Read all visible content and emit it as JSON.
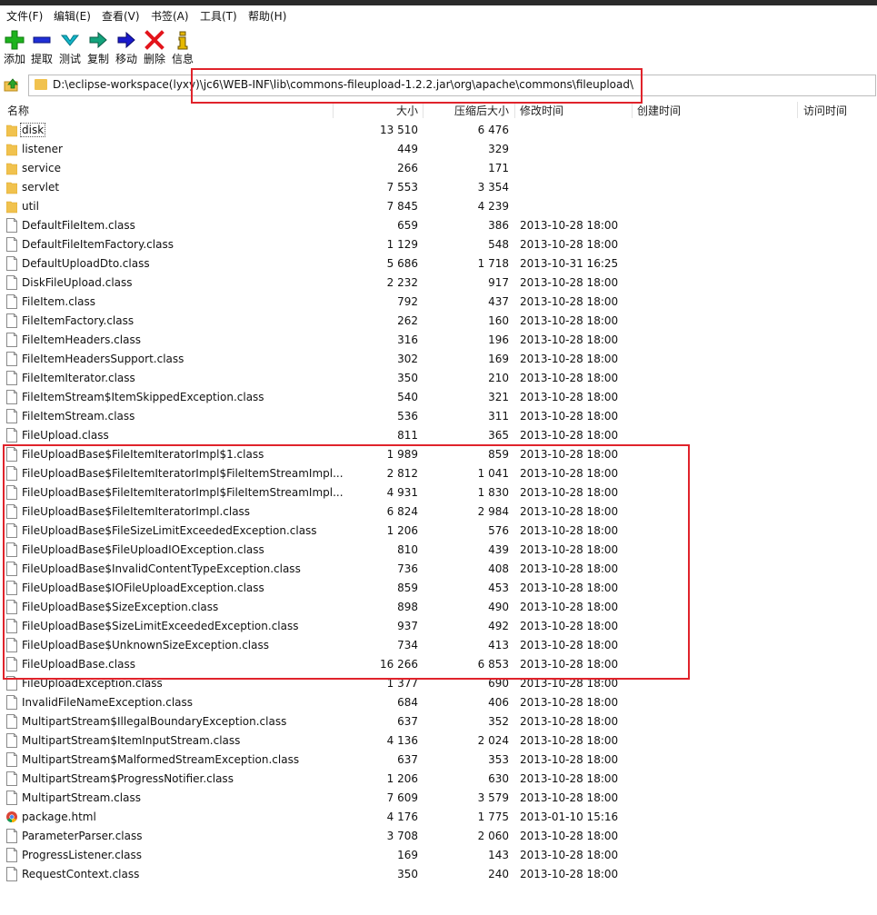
{
  "menu": [
    "文件(F)",
    "编辑(E)",
    "查看(V)",
    "书签(A)",
    "工具(T)",
    "帮助(H)"
  ],
  "toolbar": [
    {
      "label": "添加",
      "icon": "add-icon",
      "color": "#1db31d"
    },
    {
      "label": "提取",
      "icon": "extract-icon",
      "color": "#1f2fd6"
    },
    {
      "label": "测试",
      "icon": "test-icon",
      "color": "#12b5c9"
    },
    {
      "label": "复制",
      "icon": "copy-icon",
      "color": "#0f8a6a"
    },
    {
      "label": "移动",
      "icon": "move-icon",
      "color": "#1a1acc"
    },
    {
      "label": "删除",
      "icon": "delete-icon",
      "color": "#e3141b"
    },
    {
      "label": "信息",
      "icon": "info-icon",
      "color": "#e6b800"
    }
  ],
  "address": {
    "path": "D:\\eclipse-workspace(lyxy)\\jc6\\WEB-INF\\lib\\commons-fileupload-1.2.2.jar\\org\\apache\\commons\\fileupload\\"
  },
  "columns": {
    "name": "名称",
    "size": "大小",
    "packed": "压缩后大小",
    "modified": "修改时间",
    "created": "创建时间",
    "accessed": "访问时间"
  },
  "highlight_color": "#e0232b",
  "files": [
    {
      "name": "disk",
      "type": "folder",
      "size": "13 510",
      "packed": "6 476",
      "modified": ""
    },
    {
      "name": "listener",
      "type": "folder",
      "size": "449",
      "packed": "329",
      "modified": ""
    },
    {
      "name": "service",
      "type": "folder",
      "size": "266",
      "packed": "171",
      "modified": ""
    },
    {
      "name": "servlet",
      "type": "folder",
      "size": "7 553",
      "packed": "3 354",
      "modified": ""
    },
    {
      "name": "util",
      "type": "folder",
      "size": "7 845",
      "packed": "4 239",
      "modified": ""
    },
    {
      "name": "DefaultFileItem.class",
      "type": "file",
      "size": "659",
      "packed": "386",
      "modified": "2013-10-28 18:00"
    },
    {
      "name": "DefaultFileItemFactory.class",
      "type": "file",
      "size": "1 129",
      "packed": "548",
      "modified": "2013-10-28 18:00"
    },
    {
      "name": "DefaultUploadDto.class",
      "type": "file",
      "size": "5 686",
      "packed": "1 718",
      "modified": "2013-10-31 16:25"
    },
    {
      "name": "DiskFileUpload.class",
      "type": "file",
      "size": "2 232",
      "packed": "917",
      "modified": "2013-10-28 18:00"
    },
    {
      "name": "FileItem.class",
      "type": "file",
      "size": "792",
      "packed": "437",
      "modified": "2013-10-28 18:00"
    },
    {
      "name": "FileItemFactory.class",
      "type": "file",
      "size": "262",
      "packed": "160",
      "modified": "2013-10-28 18:00"
    },
    {
      "name": "FileItemHeaders.class",
      "type": "file",
      "size": "316",
      "packed": "196",
      "modified": "2013-10-28 18:00"
    },
    {
      "name": "FileItemHeadersSupport.class",
      "type": "file",
      "size": "302",
      "packed": "169",
      "modified": "2013-10-28 18:00"
    },
    {
      "name": "FileItemIterator.class",
      "type": "file",
      "size": "350",
      "packed": "210",
      "modified": "2013-10-28 18:00"
    },
    {
      "name": "FileItemStream$ItemSkippedException.class",
      "type": "file",
      "size": "540",
      "packed": "321",
      "modified": "2013-10-28 18:00"
    },
    {
      "name": "FileItemStream.class",
      "type": "file",
      "size": "536",
      "packed": "311",
      "modified": "2013-10-28 18:00"
    },
    {
      "name": "FileUpload.class",
      "type": "file",
      "size": "811",
      "packed": "365",
      "modified": "2013-10-28 18:00"
    },
    {
      "name": "FileUploadBase$FileItemIteratorImpl$1.class",
      "type": "file",
      "size": "1 989",
      "packed": "859",
      "modified": "2013-10-28 18:00"
    },
    {
      "name": "FileUploadBase$FileItemIteratorImpl$FileItemStreamImpl...",
      "type": "file",
      "size": "2 812",
      "packed": "1 041",
      "modified": "2013-10-28 18:00"
    },
    {
      "name": "FileUploadBase$FileItemIteratorImpl$FileItemStreamImpl...",
      "type": "file",
      "size": "4 931",
      "packed": "1 830",
      "modified": "2013-10-28 18:00"
    },
    {
      "name": "FileUploadBase$FileItemIteratorImpl.class",
      "type": "file",
      "size": "6 824",
      "packed": "2 984",
      "modified": "2013-10-28 18:00"
    },
    {
      "name": "FileUploadBase$FileSizeLimitExceededException.class",
      "type": "file",
      "size": "1 206",
      "packed": "576",
      "modified": "2013-10-28 18:00"
    },
    {
      "name": "FileUploadBase$FileUploadIOException.class",
      "type": "file",
      "size": "810",
      "packed": "439",
      "modified": "2013-10-28 18:00"
    },
    {
      "name": "FileUploadBase$InvalidContentTypeException.class",
      "type": "file",
      "size": "736",
      "packed": "408",
      "modified": "2013-10-28 18:00"
    },
    {
      "name": "FileUploadBase$IOFileUploadException.class",
      "type": "file",
      "size": "859",
      "packed": "453",
      "modified": "2013-10-28 18:00"
    },
    {
      "name": "FileUploadBase$SizeException.class",
      "type": "file",
      "size": "898",
      "packed": "490",
      "modified": "2013-10-28 18:00"
    },
    {
      "name": "FileUploadBase$SizeLimitExceededException.class",
      "type": "file",
      "size": "937",
      "packed": "492",
      "modified": "2013-10-28 18:00"
    },
    {
      "name": "FileUploadBase$UnknownSizeException.class",
      "type": "file",
      "size": "734",
      "packed": "413",
      "modified": "2013-10-28 18:00"
    },
    {
      "name": "FileUploadBase.class",
      "type": "file",
      "size": "16 266",
      "packed": "6 853",
      "modified": "2013-10-28 18:00"
    },
    {
      "name": "FileUploadException.class",
      "type": "file",
      "size": "1 377",
      "packed": "690",
      "modified": "2013-10-28 18:00"
    },
    {
      "name": "InvalidFileNameException.class",
      "type": "file",
      "size": "684",
      "packed": "406",
      "modified": "2013-10-28 18:00"
    },
    {
      "name": "MultipartStream$IllegalBoundaryException.class",
      "type": "file",
      "size": "637",
      "packed": "352",
      "modified": "2013-10-28 18:00"
    },
    {
      "name": "MultipartStream$ItemInputStream.class",
      "type": "file",
      "size": "4 136",
      "packed": "2 024",
      "modified": "2013-10-28 18:00"
    },
    {
      "name": "MultipartStream$MalformedStreamException.class",
      "type": "file",
      "size": "637",
      "packed": "353",
      "modified": "2013-10-28 18:00"
    },
    {
      "name": "MultipartStream$ProgressNotifier.class",
      "type": "file",
      "size": "1 206",
      "packed": "630",
      "modified": "2013-10-28 18:00"
    },
    {
      "name": "MultipartStream.class",
      "type": "file",
      "size": "7 609",
      "packed": "3 579",
      "modified": "2013-10-28 18:00"
    },
    {
      "name": "package.html",
      "type": "html",
      "size": "4 176",
      "packed": "1 775",
      "modified": "2013-01-10 15:16"
    },
    {
      "name": "ParameterParser.class",
      "type": "file",
      "size": "3 708",
      "packed": "2 060",
      "modified": "2013-10-28 18:00"
    },
    {
      "name": "ProgressListener.class",
      "type": "file",
      "size": "169",
      "packed": "143",
      "modified": "2013-10-28 18:00"
    },
    {
      "name": "RequestContext.class",
      "type": "file",
      "size": "350",
      "packed": "240",
      "modified": "2013-10-28 18:00"
    }
  ]
}
